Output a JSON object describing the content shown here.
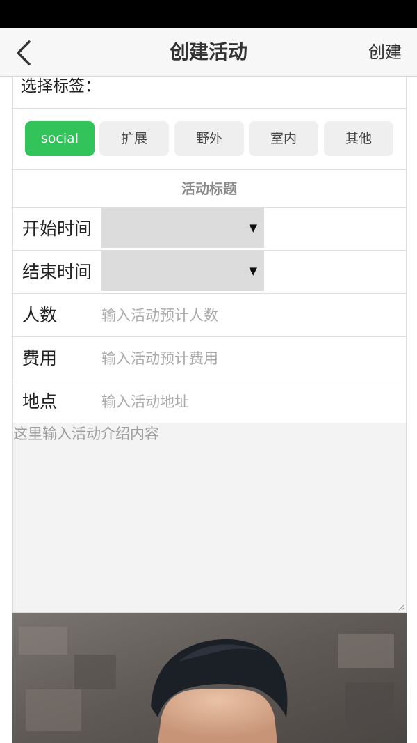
{
  "nav": {
    "title": "创建活动",
    "create_label": "创建",
    "back_icon": "chevron-left-icon"
  },
  "tags": {
    "label": "选择标签：",
    "items": [
      {
        "label": "social",
        "active": true
      },
      {
        "label": "扩展",
        "active": false
      },
      {
        "label": "野外",
        "active": false
      },
      {
        "label": "室内",
        "active": false
      },
      {
        "label": "其他",
        "active": false
      }
    ],
    "active_color": "#32c45a"
  },
  "form": {
    "title_label": "活动标题",
    "start_time": {
      "label": "开始时间",
      "value": ""
    },
    "end_time": {
      "label": "结束时间",
      "value": ""
    },
    "people": {
      "label": "人数",
      "placeholder": "输入活动预计人数"
    },
    "cost": {
      "label": "费用",
      "placeholder": "输入活动预计费用"
    },
    "location": {
      "label": "地点",
      "placeholder": "输入活动地址"
    },
    "description_placeholder": "这里输入活动介绍内容"
  },
  "select_arrow": "▼"
}
